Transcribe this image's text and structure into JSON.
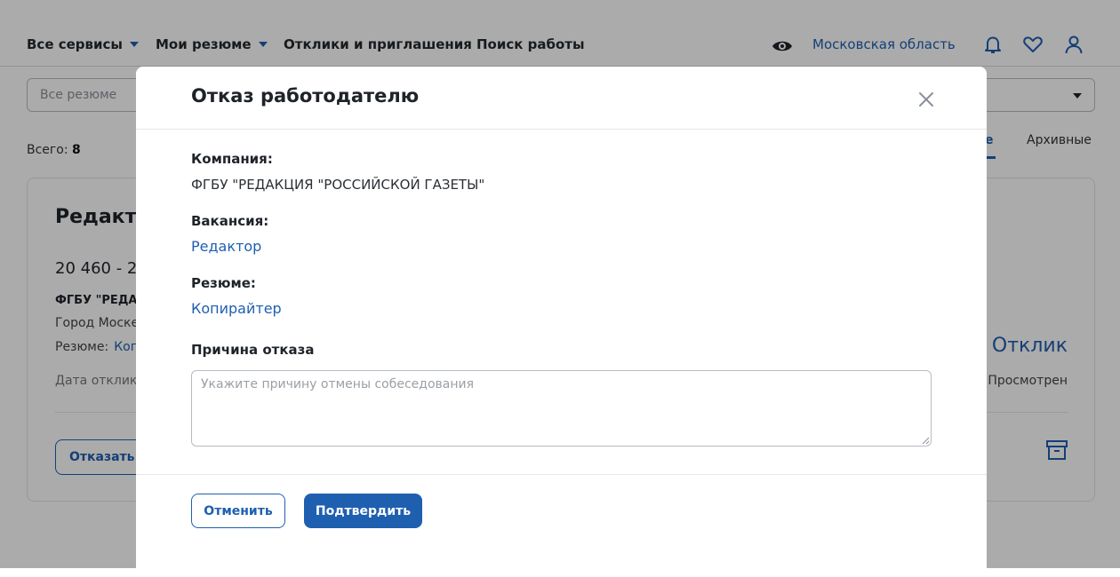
{
  "header": {
    "nav": [
      {
        "label": "Все сервисы",
        "has_dropdown": true
      },
      {
        "label": "Мои резюме",
        "has_dropdown": true
      },
      {
        "label": "Отклики и приглашения",
        "has_dropdown": false
      },
      {
        "label": "Поиск работы",
        "has_dropdown": false
      }
    ],
    "region": "Московская область",
    "icons": [
      "eye-icon",
      "bell-icon",
      "heart-icon",
      "user-icon"
    ]
  },
  "filter": {
    "resume_select_placeholder": "Все резюме"
  },
  "summary": {
    "total_label": "Всего:",
    "total_count": "8"
  },
  "tabs": {
    "active_partial": "е",
    "archive": "Архивные"
  },
  "card": {
    "title": "Редакто",
    "salary": "20 460 - 2",
    "company": "ФГБУ \"РЕДА",
    "city": "Город Моске",
    "resume_label": "Резюме:",
    "resume_link": "Ког",
    "date_label": "Дата отклик",
    "reject_button": "Отказать р",
    "status": "Отклик",
    "viewed": "Просмотрен",
    "archive_icon": "archive-icon"
  },
  "modal": {
    "title": "Отказ работодателю",
    "company_label": "Компания:",
    "company_value": "ФГБУ \"РЕДАКЦИЯ \"РОССИЙСКОЙ ГАЗЕТЫ\"",
    "vacancy_label": "Вакансия:",
    "vacancy_value": "Редактор",
    "resume_label": "Резюме:",
    "resume_value": "Копирайтер",
    "reason_label": "Причина отказа",
    "reason_placeholder": "Укажите причину отмены собеседования",
    "reason_value": "",
    "cancel_button": "Отменить",
    "confirm_button": "Подтвердить"
  },
  "colors": {
    "accent": "#1f5fb0",
    "overlay": "rgba(0,0,0,0.33)",
    "text": "#1f2329"
  }
}
